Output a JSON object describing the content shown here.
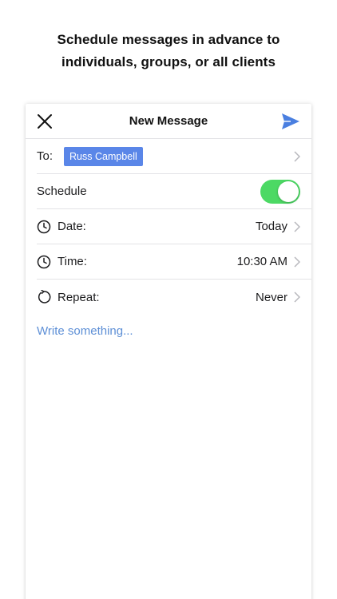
{
  "headline": {
    "line1": "Schedule messages in advance to",
    "line2": "individuals, groups, or all clients"
  },
  "header": {
    "title": "New Message",
    "close_icon": "close-icon",
    "send_icon": "send-icon"
  },
  "to": {
    "label": "To:",
    "recipient": "Russ Campbell"
  },
  "schedule": {
    "label": "Schedule",
    "enabled": true
  },
  "date": {
    "label": "Date:",
    "value": "Today",
    "icon": "clock-icon"
  },
  "time": {
    "label": "Time:",
    "value": "10:30 AM",
    "icon": "clock-icon"
  },
  "repeat": {
    "label": "Repeat:",
    "value": "Never",
    "icon": "repeat-icon"
  },
  "compose": {
    "placeholder": "Write something..."
  },
  "colors": {
    "accent": "#5a86e8",
    "toggle_on": "#4cd964",
    "placeholder": "#5d8fd6"
  }
}
